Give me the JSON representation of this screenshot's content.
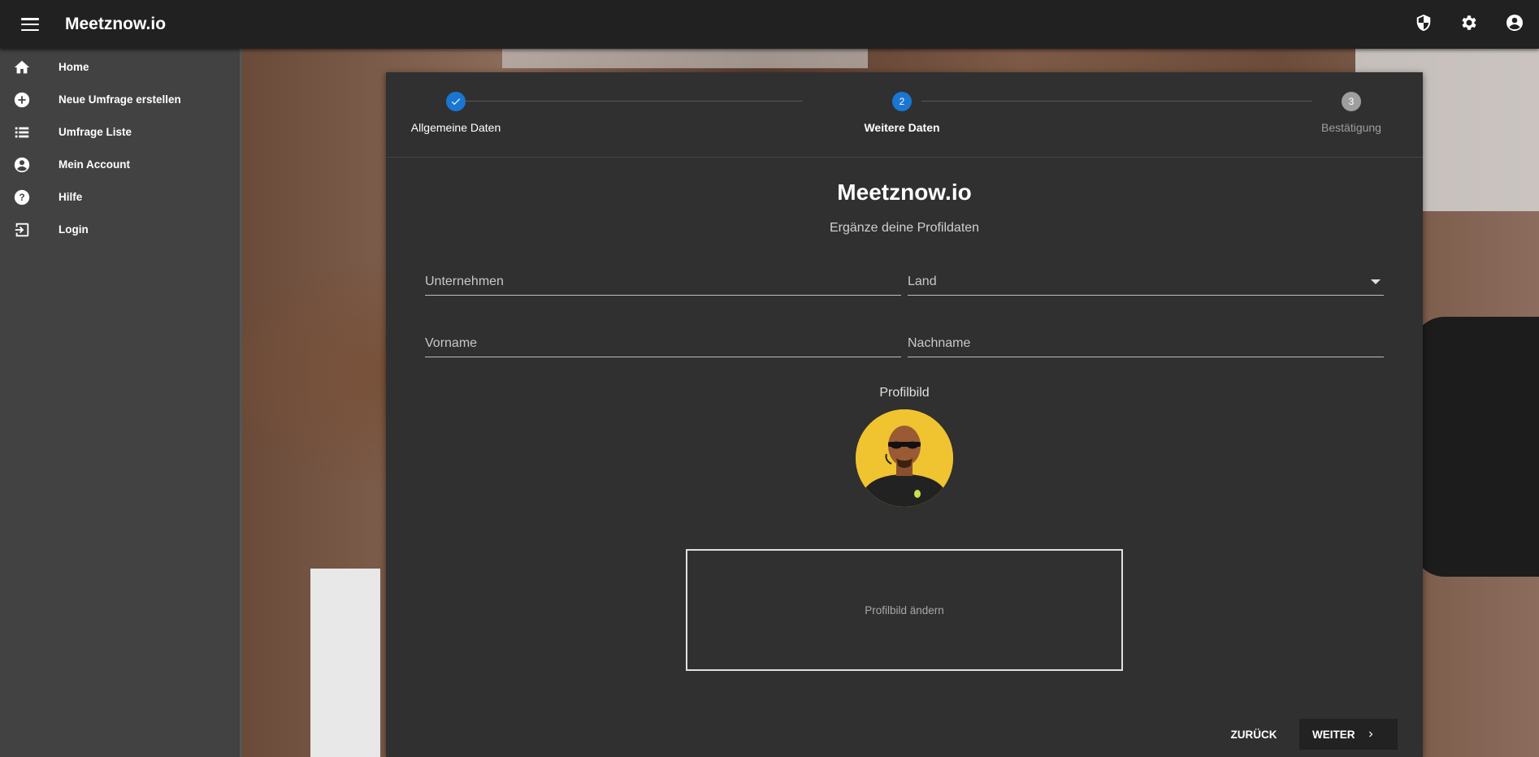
{
  "app": {
    "title": "Meetznow.io"
  },
  "topbar": {
    "icons": [
      "shield-icon",
      "gear-icon",
      "account-circle-icon"
    ]
  },
  "sidebar": {
    "items": [
      {
        "label": "Home",
        "icon": "home-icon"
      },
      {
        "label": "Neue Umfrage erstellen",
        "icon": "add-circle-icon"
      },
      {
        "label": "Umfrage Liste",
        "icon": "list-icon"
      },
      {
        "label": "Mein Account",
        "icon": "account-circle-icon"
      },
      {
        "label": "Hilfe",
        "icon": "help-icon"
      },
      {
        "label": "Login",
        "icon": "login-icon"
      }
    ]
  },
  "stepper": {
    "steps": [
      {
        "number": "1",
        "label": "Allgemeine Daten",
        "state": "completed"
      },
      {
        "number": "2",
        "label": "Weitere Daten",
        "state": "active"
      },
      {
        "number": "3",
        "label": "Bestätigung",
        "state": "inactive"
      }
    ]
  },
  "form": {
    "brand": "Meetznow.io",
    "subtitle": "Ergänze deine Profildaten",
    "company_placeholder": "Unternehmen",
    "country_placeholder": "Land",
    "firstname_placeholder": "Vorname",
    "lastname_placeholder": "Nachname",
    "profile_label": "Profilbild",
    "change_picture": "Profilbild ändern"
  },
  "actions": {
    "back_label": "ZURÜCK",
    "next_label": "WEITER"
  },
  "colors": {
    "accent": "#1976d2",
    "topbar": "#212121",
    "sidebar": "#424242",
    "card": "#303030"
  }
}
